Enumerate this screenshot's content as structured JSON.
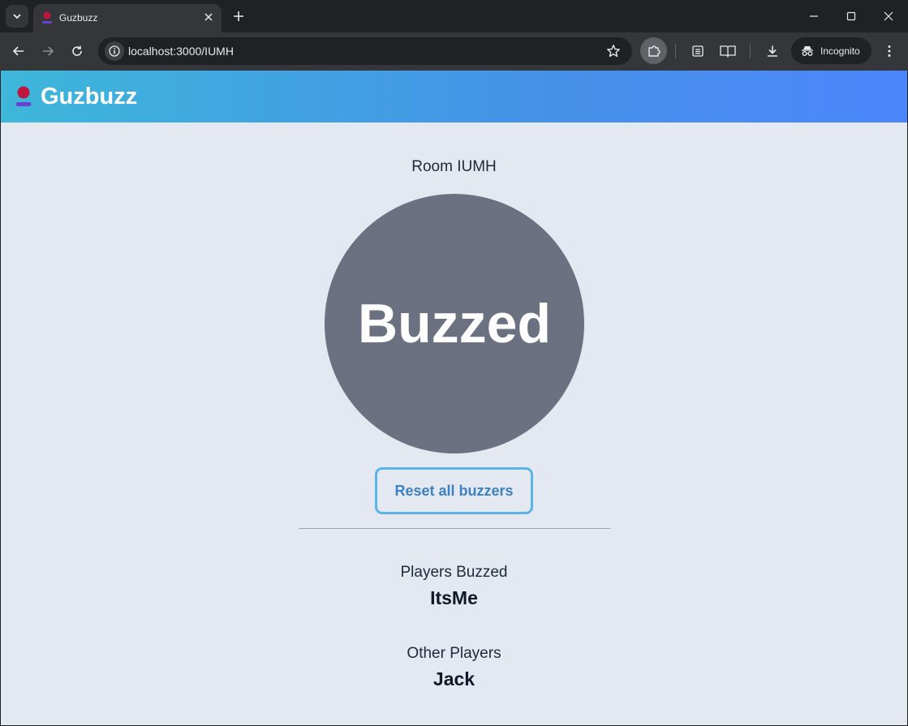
{
  "browser": {
    "tab_title": "Guzbuzz",
    "url": "localhost:3000/IUMH",
    "incognito_label": "Incognito"
  },
  "app": {
    "brand": "Guzbuzz",
    "room_title": "Room IUMH",
    "buzzer_label": "Buzzed",
    "reset_button_label": "Reset all buzzers",
    "players_buzzed_label": "Players Buzzed",
    "players_buzzed": [
      "ItsMe"
    ],
    "other_players_label": "Other Players",
    "other_players": [
      "Jack"
    ]
  },
  "colors": {
    "header_gradient_start": "#3db7da",
    "header_gradient_end": "#4b86fb",
    "page_background": "#e3e8f1",
    "buzzer": "#6b7181",
    "reset_border": "#5ab4ea",
    "reset_text": "#3b82c4"
  }
}
